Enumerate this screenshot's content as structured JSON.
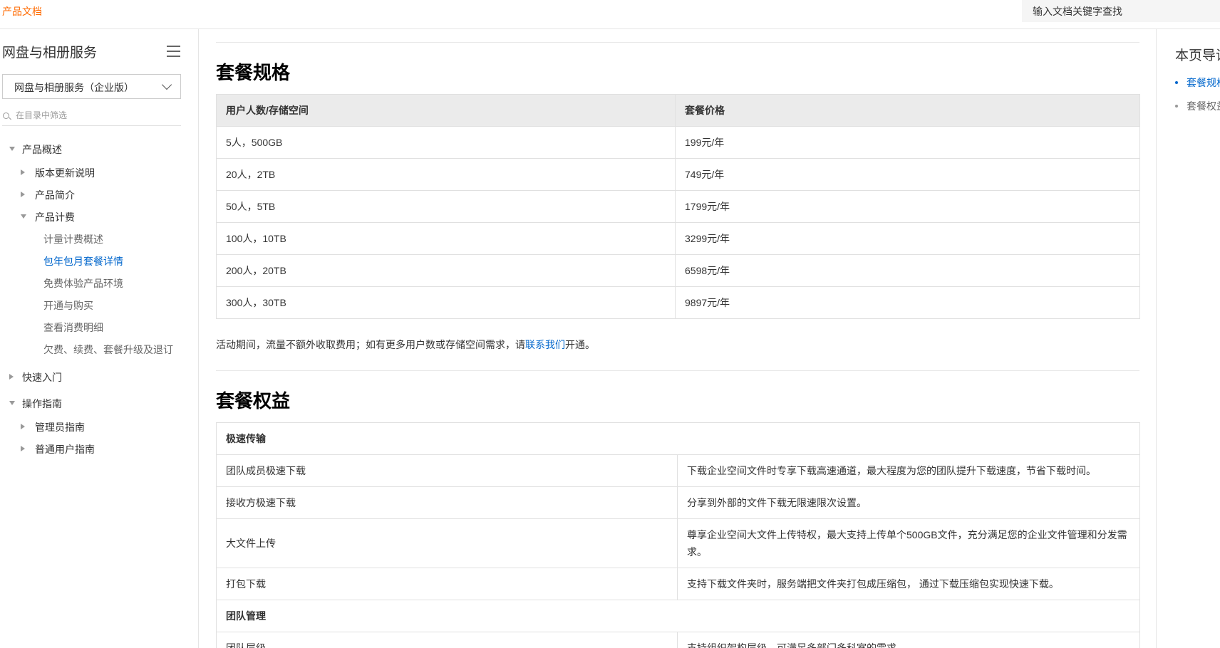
{
  "topbar": {
    "brand": "产品文档",
    "search_placeholder": "输入文档关键字查找"
  },
  "sidebar": {
    "title": "网盘与相册服务",
    "select_value": "网盘与相册服务（企业版）",
    "filter_placeholder": "在目录中筛选",
    "items": [
      {
        "label": "产品概述"
      },
      {
        "label": "版本更新说明"
      },
      {
        "label": "产品简介"
      },
      {
        "label": "产品计费"
      },
      {
        "label": "计量计费概述"
      },
      {
        "label": "包年包月套餐详情"
      },
      {
        "label": "免费体验产品环境"
      },
      {
        "label": "开通与购买"
      },
      {
        "label": "查看消费明细"
      },
      {
        "label": "欠费、续费、套餐升级及退订"
      },
      {
        "label": "快速入门"
      },
      {
        "label": "操作指南"
      },
      {
        "label": "管理员指南"
      },
      {
        "label": "普通用户指南"
      }
    ]
  },
  "main": {
    "spec_heading": "套餐规格",
    "spec_table": {
      "headers": [
        "用户人数/存储空间",
        "套餐价格"
      ],
      "rows": [
        [
          "5人，500GB",
          "199元/年"
        ],
        [
          "20人，2TB",
          "749元/年"
        ],
        [
          "50人，5TB",
          "1799元/年"
        ],
        [
          "100人，10TB",
          "3299元/年"
        ],
        [
          "200人，20TB",
          "6598元/年"
        ],
        [
          "300人，30TB",
          "9897元/年"
        ]
      ]
    },
    "note_before": "活动期间，流量不额外收取费用；如有更多用户数或存储空间需求，请",
    "note_link": "联系我们",
    "note_after": "开通。",
    "rights_heading": "套餐权益",
    "rights_table": {
      "group1": "极速传输",
      "rows1": [
        [
          "团队成员极速下载",
          "下载企业空间文件时专享下载高速通道，最大程度为您的团队提升下载速度，节省下载时间。"
        ],
        [
          "接收方极速下载",
          "分享到外部的文件下载无限速限次设置。"
        ],
        [
          "大文件上传",
          "尊享企业空间大文件上传特权，最大支持上传单个500GB文件，充分满足您的企业文件管理和分发需求。"
        ],
        [
          "打包下载",
          "支持下载文件夹时，服务端把文件夹打包成压缩包， 通过下载压缩包实现快速下载。"
        ]
      ],
      "group2": "团队管理",
      "rows2": [
        [
          "团队层级",
          "支持组织架构层级，可满足多部门多科室的需求"
        ]
      ]
    }
  },
  "toc": {
    "title": "本页导读",
    "items": [
      {
        "label": "套餐规格",
        "active": true
      },
      {
        "label": "套餐权益",
        "active": false
      }
    ],
    "active_color": "#0066cc",
    "inactive_color": "#666666"
  },
  "colors": {
    "brand": "#ff6a00",
    "link": "#0066cc"
  }
}
